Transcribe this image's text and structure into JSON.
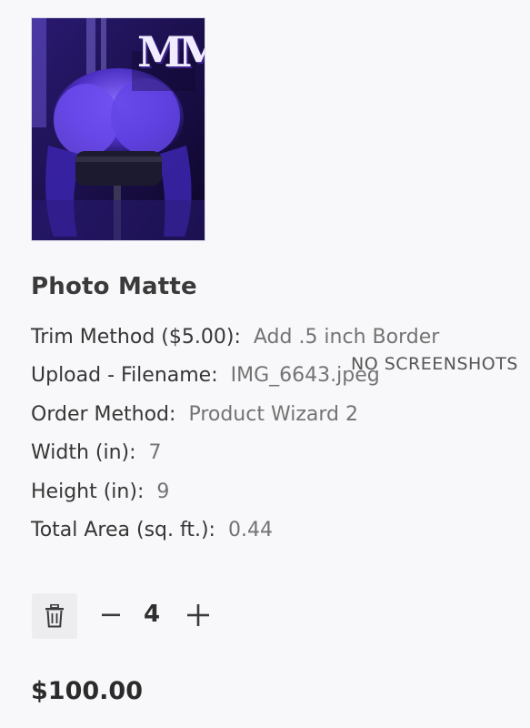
{
  "product": {
    "image_alt": "Purple-tinted product photo with MM monogram",
    "logo_text": "MM",
    "title": "Photo Matte"
  },
  "attributes": [
    {
      "label": "Trim Method ($5.00):",
      "value": "Add .5 inch Border"
    },
    {
      "label": "Upload - Filename:",
      "value": "IMG_6643.jpeg"
    },
    {
      "label": "Order Method:",
      "value": "Product Wizard 2"
    },
    {
      "label": "Width (in):",
      "value": "7"
    },
    {
      "label": "Height (in):",
      "value": "9"
    },
    {
      "label": "Total Area (sq. ft.):",
      "value": "0.44"
    }
  ],
  "watermark": "NO SCREENSHOTS",
  "quantity": {
    "value": "4",
    "decrement_icon": "minus-icon",
    "increment_icon": "plus-icon",
    "remove_icon": "trash-icon"
  },
  "price": "$100.00",
  "colors": {
    "image_tint": "#5a3bd8",
    "text_primary": "#363636",
    "text_secondary": "#737373"
  }
}
